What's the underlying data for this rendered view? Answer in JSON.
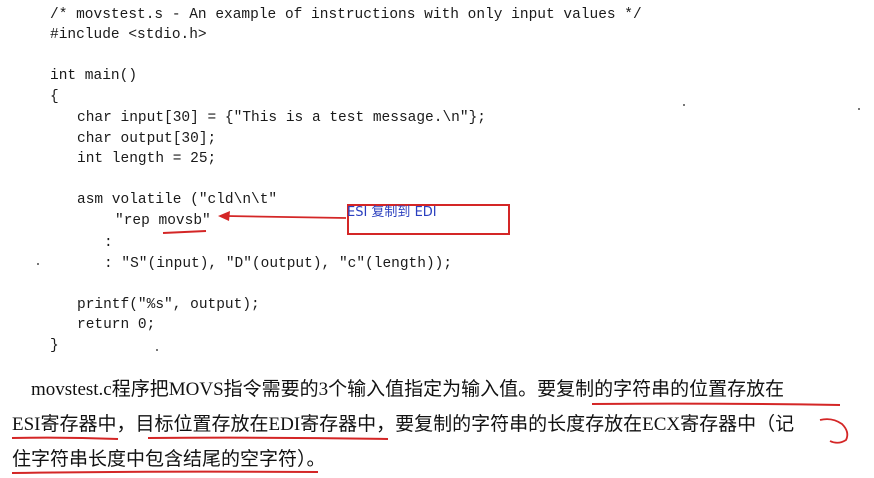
{
  "code": {
    "lines": [
      "/* movstest.s - An example of instructions with only input values */",
      "#include <stdio.h>",
      "int main()",
      "{",
      "char input[30] = {\"This is a test message.\\n\"};",
      "char output[30];",
      "int length = 25;",
      "asm volatile (\"cld\\n\\t\"",
      "\"rep movsb\"",
      ":",
      ": \"S\"(input), \"D\"(output), \"c\"(length));",
      "printf(\"%s\", output);",
      "return 0;",
      "}"
    ]
  },
  "annotation": {
    "text": "ESI 复制到 EDI",
    "color": "#d42626",
    "text_color": "#2a3fbf"
  },
  "paragraph": {
    "line1": "    movstest.c程序把MOVS指令需要的3个输入值指定为输入值。要复制的字符串的位置存放在",
    "line2": "ESI寄存器中，目标位置存放在EDI寄存器中，要复制的字符串的长度存放在ECX寄存器中（记",
    "line3": "住字符串长度中包含结尾的空字符）。"
  }
}
